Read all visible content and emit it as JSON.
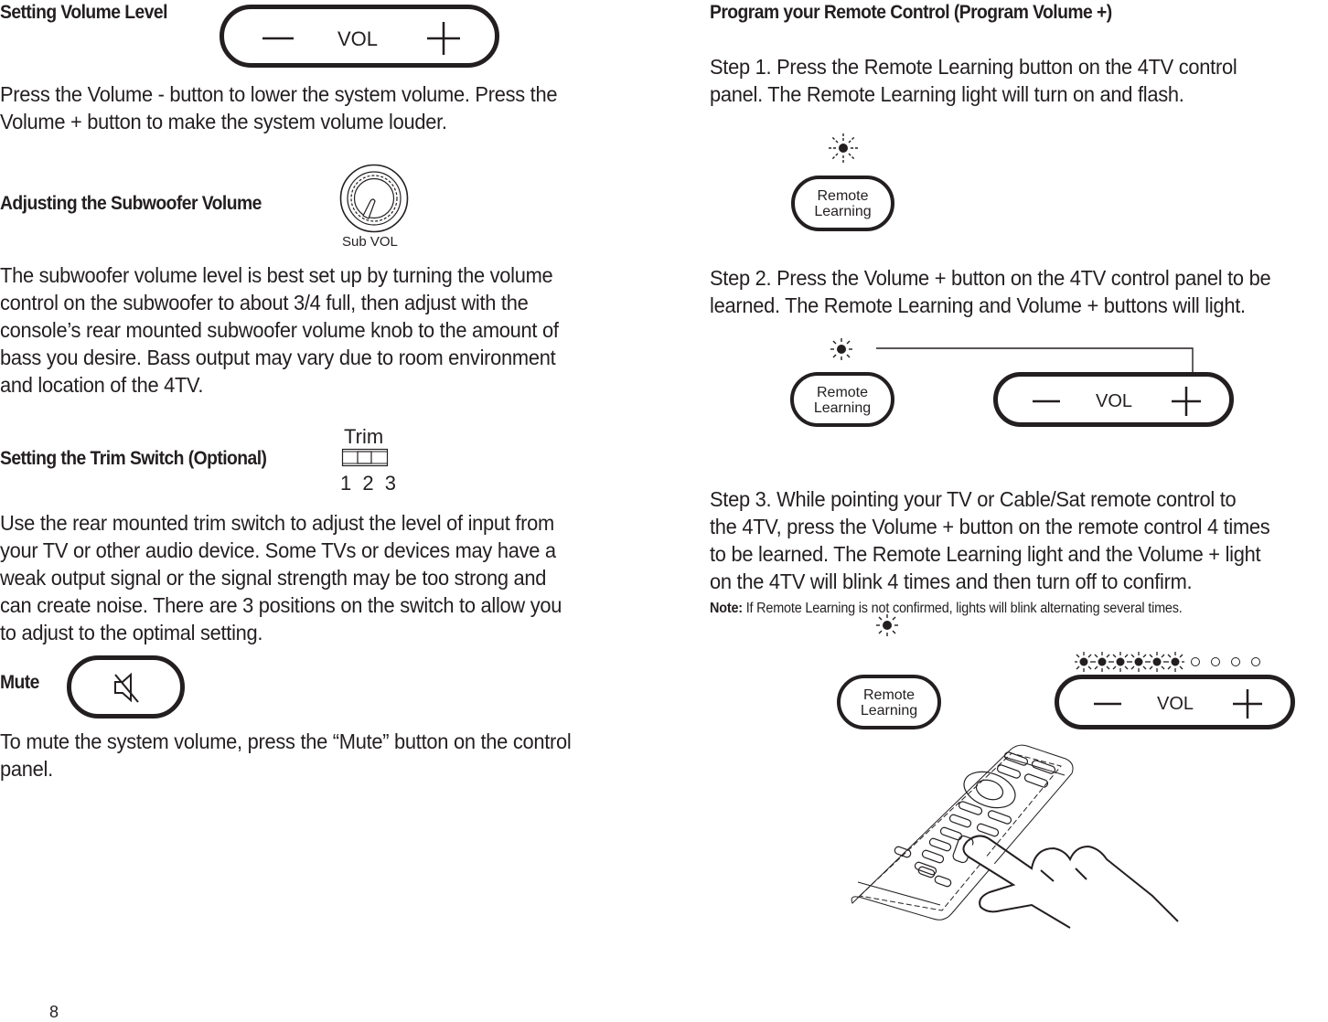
{
  "page_number": "8",
  "left_column": {
    "volume": {
      "heading": "Setting Volume Level",
      "control_label": "VOL",
      "paragraph": [
        "Press the Volume - button to lower the system volume. Press the",
        "Volume + button to make the system volume louder."
      ]
    },
    "subwoofer": {
      "heading": "Adjusting the Subwoofer Volume",
      "knob_label": "Sub VOL",
      "knob_level_fraction": 0.75,
      "paragraph": [
        "The subwoofer volume level is best set up by turning the volume",
        "control on the subwoofer to about 3/4 full, then adjust with the",
        "console’s rear mounted subwoofer volume knob to the amount of",
        "bass you desire. Bass output may vary due to room environment",
        "and location of the 4TV."
      ]
    },
    "trim": {
      "heading": "Setting the Trim Switch (Optional)",
      "switch_label": "Trim",
      "positions": [
        "1",
        "2",
        "3"
      ],
      "selected_position": "2",
      "paragraph": [
        "Use the rear mounted trim switch to adjust the level of input from",
        "your TV or other audio device. Some TVs or devices may have a",
        "weak output signal or the signal strength may be too strong and",
        "can create noise. There are 3 positions on the switch to allow you",
        "to adjust to the optimal setting."
      ]
    },
    "mute": {
      "heading": "Mute",
      "icon": "speaker-muted-icon",
      "paragraph": [
        "To mute the system volume, press the “Mute” button on the control",
        "panel."
      ]
    }
  },
  "right_column": {
    "heading": "Program your Remote Control (Program Volume +)",
    "step1": [
      "Step 1. Press the Remote Learning button on the 4TV control",
      "panel. The Remote Learning light will turn on and flash."
    ],
    "step2": [
      "Step 2. Press the Volume + button on the 4TV control panel to be",
      "learned. The Remote Learning and Volume + buttons will light."
    ],
    "step3": [
      "Step 3. While pointing your TV or Cable/Sat remote control to",
      "the 4TV, press the Volume + button on the remote control 4 times",
      "to be learned. The Remote Learning light and the Volume + light",
      "on the 4TV will blink 4 times and then turn off to confirm."
    ],
    "note_label": "Note:",
    "note_text": " If Remote Learning is not confirmed, lights will blink alternating several times.",
    "remote_learning_label": [
      "Remote",
      "Learning"
    ],
    "vol_label": "VOL",
    "blink_sequence": {
      "lit": 6,
      "unlit": 4
    }
  }
}
